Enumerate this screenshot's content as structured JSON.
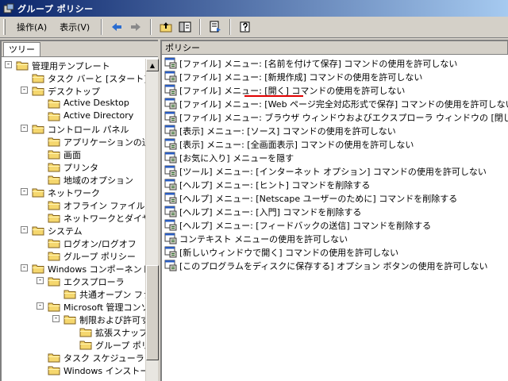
{
  "window": {
    "title": "グループ ポリシー"
  },
  "menubar": {
    "action": "操作(A)",
    "view": "表示(V)"
  },
  "toolbar": {
    "icons": [
      "back-arrow-icon",
      "forward-arrow-icon",
      "up-folder-icon",
      "show-hide-tree-icon",
      "export-list-icon",
      "help-icon"
    ]
  },
  "left_pane": {
    "tab": "ツリー",
    "tree": [
      {
        "label": "管理用テンプレート",
        "level": 0,
        "expander": "-"
      },
      {
        "label": "タスク バーと [スタート] メニュー",
        "level": 1,
        "expander": ""
      },
      {
        "label": "デスクトップ",
        "level": 1,
        "expander": "-"
      },
      {
        "label": "Active Desktop",
        "level": 2,
        "expander": ""
      },
      {
        "label": "Active Directory",
        "level": 2,
        "expander": ""
      },
      {
        "label": "コントロール パネル",
        "level": 1,
        "expander": "-"
      },
      {
        "label": "アプリケーションの追加と削除",
        "level": 2,
        "expander": ""
      },
      {
        "label": "画面",
        "level": 2,
        "expander": ""
      },
      {
        "label": "プリンタ",
        "level": 2,
        "expander": ""
      },
      {
        "label": "地域のオプション",
        "level": 2,
        "expander": ""
      },
      {
        "label": "ネットワーク",
        "level": 1,
        "expander": "-"
      },
      {
        "label": "オフライン ファイル",
        "level": 2,
        "expander": ""
      },
      {
        "label": "ネットワークとダイヤルアップ接続",
        "level": 2,
        "expander": ""
      },
      {
        "label": "システム",
        "level": 1,
        "expander": "-"
      },
      {
        "label": "ログオン/ログオフ",
        "level": 2,
        "expander": ""
      },
      {
        "label": "グループ ポリシー",
        "level": 2,
        "expander": ""
      },
      {
        "label": "Windows コンポーネント",
        "level": 1,
        "expander": "-"
      },
      {
        "label": "エクスプローラ",
        "level": 2,
        "expander": "-"
      },
      {
        "label": "共通オープン ファイル ダイアログ",
        "level": 3,
        "expander": ""
      },
      {
        "label": "Microsoft 管理コンソール",
        "level": 2,
        "expander": "-"
      },
      {
        "label": "制限および許可するスナップイン",
        "level": 3,
        "expander": "-"
      },
      {
        "label": "拡張スナップイン",
        "level": 4,
        "expander": ""
      },
      {
        "label": "グループ ポリシー",
        "level": 4,
        "expander": ""
      },
      {
        "label": "タスク スケジューラ",
        "level": 2,
        "expander": ""
      },
      {
        "label": "Windows インストーラ",
        "level": 2,
        "expander": ""
      }
    ]
  },
  "right_pane": {
    "column": "ポリシー",
    "items": [
      "[ファイル] メニュー: [名前を付けて保存] コマンドの使用を許可しない",
      "[ファイル] メニュー: [新規作成] コマンドの使用を許可しない",
      "[ファイル] メニュー: [開く] コマンドの使用を許可しない",
      "[ファイル] メニュー: [Web ページ完全対応形式で保存] コマンドの使用を許可しない",
      "[ファイル] メニュー: ブラウザ ウィンドウおよびエクスプローラ ウィンドウの [閉じる] コマンドの使用を許可しない",
      "[表示] メニュー: [ソース] コマンドの使用を許可しない",
      "[表示] メニュー: [全画面表示] コマンドの使用を許可しない",
      "[お気に入り] メニューを隠す",
      "[ツール] メニュー: [インターネット オプション] コマンドの使用を許可しない",
      "[ヘルプ] メニュー: [ヒント] コマンドを削除する",
      "[ヘルプ] メニュー: [Netscape ユーザーのために] コマンドを削除する",
      "[ヘルプ] メニュー: [入門] コマンドを削除する",
      "[ヘルプ] メニュー: [フィードバックの送信] コマンドを削除する",
      "コンテキスト メニューの使用を許可しない",
      "[新しいウィンドウで開く] コマンドの使用を許可しない",
      "[このプログラムをディスクに保存する] オプション ボタンの使用を許可しない"
    ]
  },
  "colors": {
    "title_start": "#0a246a",
    "title_end": "#a6caf0",
    "folder": "#f5d76e",
    "annotation": "#e00000"
  }
}
